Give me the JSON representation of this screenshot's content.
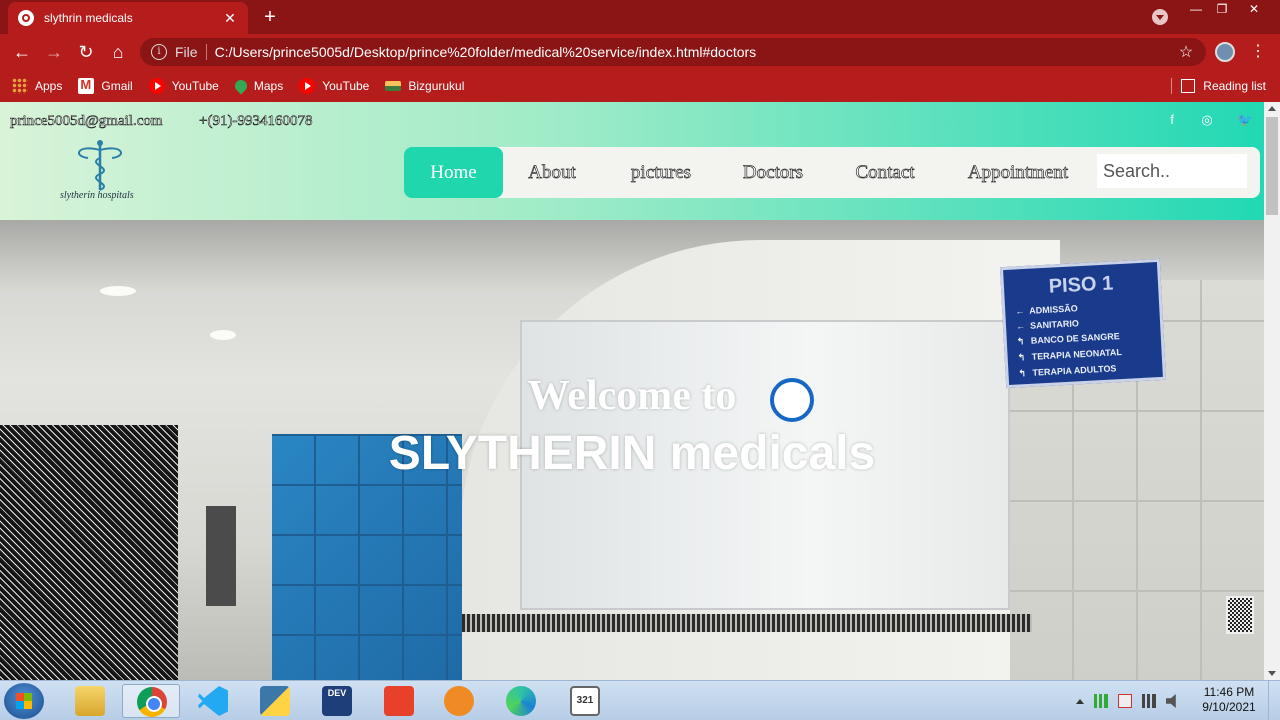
{
  "browser": {
    "tab_title": "slythrin medicals",
    "tab_close": "✕",
    "new_tab": "+",
    "win_minimize": "—",
    "win_restore": "❐",
    "win_close": "✕",
    "omnibox_file": "File",
    "url": "C:/Users/prince5005d/Desktop/prince%20folder/medical%20service/index.html#doctors",
    "bookmarks": [
      {
        "label": "Apps",
        "icon": "apps-grid-icon"
      },
      {
        "label": "Gmail",
        "icon": "gmail-icon"
      },
      {
        "label": "YouTube",
        "icon": "youtube-icon"
      },
      {
        "label": "Maps",
        "icon": "maps-pin-icon"
      },
      {
        "label": "YouTube",
        "icon": "youtube-icon"
      },
      {
        "label": "Bizgurukul",
        "icon": "bizgurukul-icon"
      }
    ],
    "reading_list": "Reading list"
  },
  "site": {
    "email": "prince5005d@gmail.com",
    "phone": "+(91)-9934160078",
    "logo_text": "slytherin hospitals",
    "nav": [
      "Home",
      "About",
      "pictures",
      "Doctors",
      "Contact",
      "Appointment"
    ],
    "active_nav": "Home",
    "search_placeholder": "Search..",
    "social_icons": [
      "facebook-icon",
      "instagram-icon",
      "twitter-icon"
    ],
    "hero": {
      "welcome": "Welcome to",
      "brand": "SLYTHERIN medicals"
    },
    "sign": {
      "title": "PISO 1",
      "rows": [
        "ADMISSÃO",
        "SANITARIO",
        "BANCO DE SANGRE",
        "TERAPIA NEONATAL",
        "TERAPIA ADULTOS"
      ]
    },
    "colors": {
      "accent": "#1fd6ad",
      "header_start": "#d8f3d8",
      "header_end": "#22d8b4"
    }
  },
  "taskbar": {
    "apps": [
      "file-explorer-icon",
      "chrome-icon",
      "vscode-icon",
      "python-icon",
      "devcpp-icon",
      "gitkraken-icon",
      "media-player-icon",
      "edge-icon",
      "calendar-321-icon"
    ],
    "devcpp_label": "DEV",
    "calendar_label": "321",
    "time": "11:46 PM",
    "date": "9/10/2021"
  }
}
